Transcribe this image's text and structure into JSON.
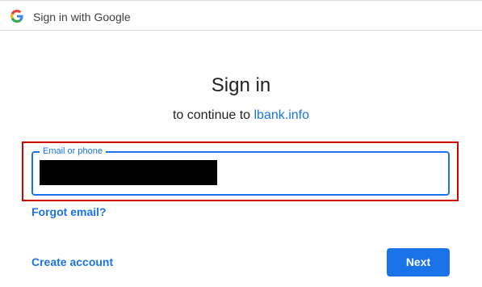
{
  "header": {
    "title": "Sign in with Google",
    "logo_icon": "google-g-icon"
  },
  "main": {
    "heading": "Sign in",
    "subtitle_prefix": "to continue to ",
    "site_name": "lbank.info"
  },
  "email_field": {
    "label": "Email or phone",
    "value": ""
  },
  "links": {
    "forgot_email": "Forgot email?",
    "create_account": "Create account"
  },
  "actions": {
    "next_label": "Next"
  },
  "colors": {
    "accent": "#1a73e8",
    "highlight": "#d50000",
    "text": "#202124"
  }
}
